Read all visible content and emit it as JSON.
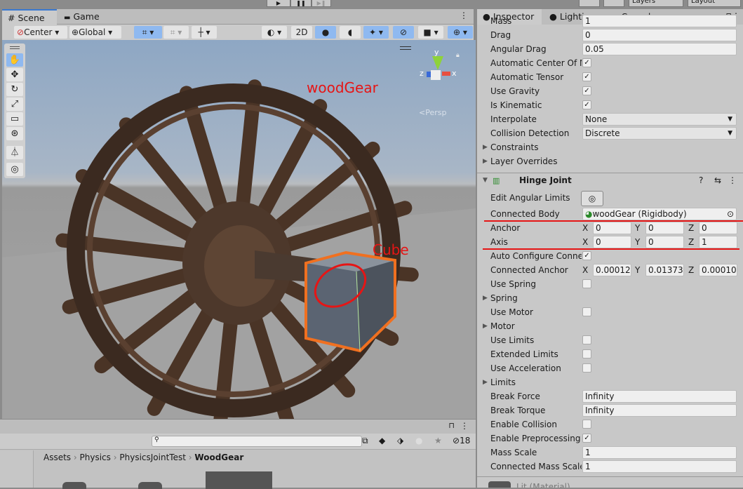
{
  "play_controls": {
    "play": "▶",
    "pause": "❚❚",
    "step": "▶❚"
  },
  "top_right": {
    "layers": "Layers",
    "layout": "Layout"
  },
  "scene_tabs": [
    {
      "label": "Scene",
      "icon": "grid-icon"
    },
    {
      "label": "Game",
      "icon": "gamepad-icon"
    }
  ],
  "scene_toolbar": {
    "pivot": "Center",
    "space": "Global",
    "mode_2d": "2D"
  },
  "scene_annotations": {
    "object1": "woodGear",
    "object2": "Cube"
  },
  "gizmo": {
    "y": "y",
    "x": "x",
    "z": "z",
    "projection": "Persp"
  },
  "tool_icons": [
    "hand-icon",
    "move-icon",
    "rotate-icon",
    "scale-icon",
    "rect-icon",
    "transform-icon",
    "custom-tool-icon",
    "view-tool-icon"
  ],
  "inspector_tabs": [
    {
      "label": "Inspector",
      "icon": "info-icon"
    },
    {
      "label": "Lighting",
      "icon": "bulb-icon"
    },
    {
      "label": "Console",
      "icon": "console-icon"
    }
  ],
  "rigidbody_rows": [
    {
      "label": "Mass",
      "type": "field",
      "value": "1"
    },
    {
      "label": "Drag",
      "type": "field",
      "value": "0"
    },
    {
      "label": "Angular Drag",
      "type": "field",
      "value": "0.05"
    },
    {
      "label": "Automatic Center Of Mass",
      "type": "check",
      "checked": true
    },
    {
      "label": "Automatic Tensor",
      "type": "check",
      "checked": true
    },
    {
      "label": "Use Gravity",
      "type": "check",
      "checked": true
    },
    {
      "label": "Is Kinematic",
      "type": "check",
      "checked": true
    },
    {
      "label": "Interpolate",
      "type": "select",
      "value": "None"
    },
    {
      "label": "Collision Detection",
      "type": "select",
      "value": "Discrete"
    },
    {
      "label": "Constraints",
      "type": "fold"
    },
    {
      "label": "Layer Overrides",
      "type": "fold"
    }
  ],
  "hinge": {
    "title": "Hinge Joint",
    "edit_angular_limits": "Edit Angular Limits",
    "rows": [
      {
        "label": "Connected Body",
        "type": "object",
        "value": "woodGear (Rigidbody)"
      },
      {
        "label": "Anchor",
        "type": "vector",
        "x": "0",
        "y": "0",
        "z": "0"
      },
      {
        "label": "Axis",
        "type": "vector",
        "x": "0",
        "y": "0",
        "z": "1"
      },
      {
        "label": "Auto Configure Connected Anchor",
        "type": "check",
        "checked": true
      },
      {
        "label": "Connected Anchor",
        "type": "vector",
        "x": "0.000120",
        "y": "0.013738",
        "z": "0.000101"
      },
      {
        "label": "Use Spring",
        "type": "check",
        "checked": false
      },
      {
        "label": "Spring",
        "type": "fold"
      },
      {
        "label": "Use Motor",
        "type": "check",
        "checked": false
      },
      {
        "label": "Motor",
        "type": "fold"
      },
      {
        "label": "Use Limits",
        "type": "check",
        "checked": false
      },
      {
        "label": "Extended Limits",
        "type": "check",
        "checked": false
      },
      {
        "label": "Use Acceleration",
        "type": "check",
        "checked": false
      },
      {
        "label": "Limits",
        "type": "fold"
      },
      {
        "label": "Break Force",
        "type": "field",
        "value": "Infinity"
      },
      {
        "label": "Break Torque",
        "type": "field",
        "value": "Infinity"
      },
      {
        "label": "Enable Collision",
        "type": "check",
        "checked": false
      },
      {
        "label": "Enable Preprocessing",
        "type": "check",
        "checked": true
      },
      {
        "label": "Mass Scale",
        "type": "field",
        "value": "1"
      },
      {
        "label": "Connected Mass Scale",
        "type": "field",
        "value": "1"
      }
    ]
  },
  "material": {
    "label": "Lit (Material)"
  },
  "project": {
    "breadcrumb": [
      "Assets",
      "Physics",
      "PhysicsJointTest",
      "WoodGear"
    ],
    "hidden_count": "18",
    "search_placeholder": ""
  },
  "colors": {
    "accent": "#3a79d0",
    "annotation": "#e61515",
    "selection": "#f07020"
  }
}
